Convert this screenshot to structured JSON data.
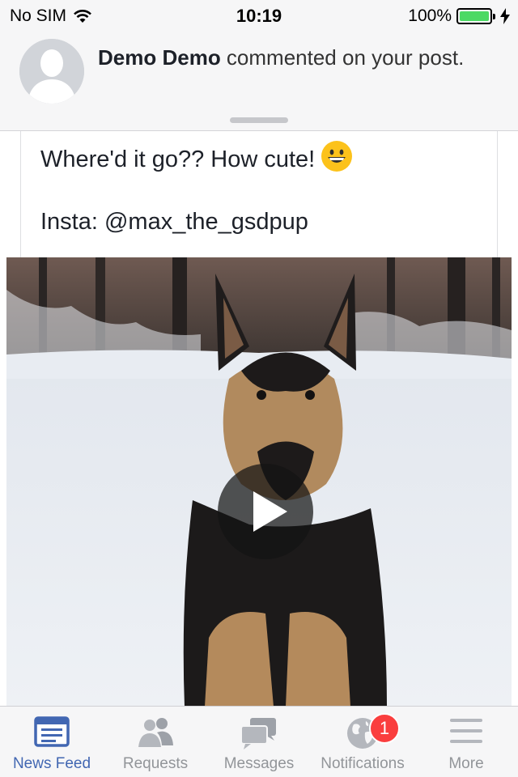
{
  "status_bar": {
    "carrier": "No SIM",
    "time": "10:19",
    "battery": "100%",
    "battery_level": 1.0
  },
  "notification": {
    "actor": "Demo Demo",
    "message": " commented on your post."
  },
  "post": {
    "line1": "Where'd it go??  How cute! ",
    "line2": "Insta: @max_the_gsdpup",
    "emoji": "grinning-face-emoji"
  },
  "video": {
    "play_icon": "play-icon"
  },
  "tab_bar": {
    "tabs": [
      {
        "label": "News Feed",
        "icon": "news-feed-icon",
        "active": true
      },
      {
        "label": "Requests",
        "icon": "friend-requests-icon"
      },
      {
        "label": "Messages",
        "icon": "messages-icon"
      },
      {
        "label": "Notifications",
        "icon": "globe-icon",
        "badge": "1"
      },
      {
        "label": "More",
        "icon": "menu-icon"
      }
    ]
  },
  "colors": {
    "accent": "#4267b2",
    "badge": "#fa3e3e",
    "battery": "#4cd964"
  }
}
